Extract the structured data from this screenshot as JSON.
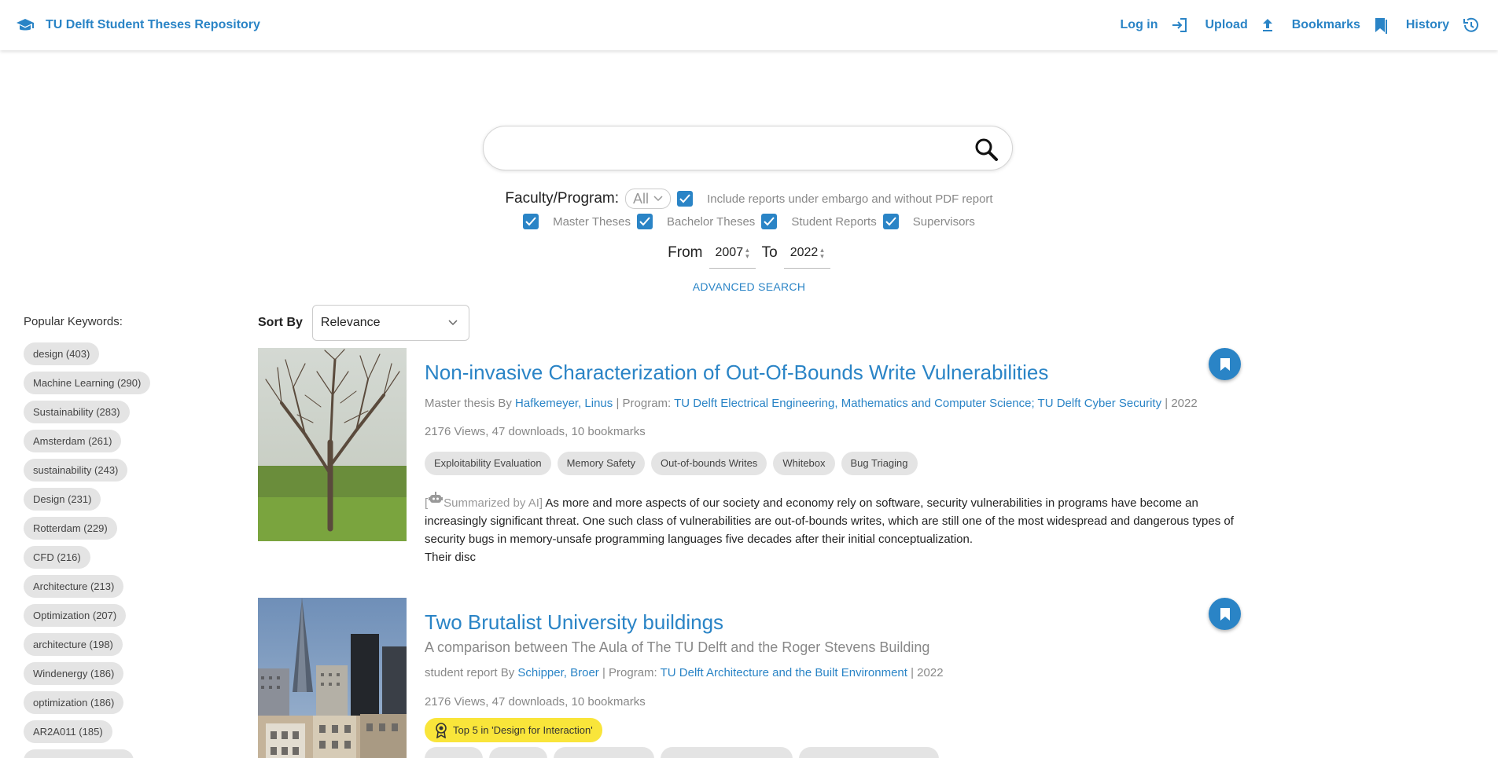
{
  "header": {
    "title": "TU Delft Student Theses Repository",
    "nav": {
      "login": "Log in",
      "upload": "Upload",
      "bookmarks": "Bookmarks",
      "history": "History"
    }
  },
  "search": {
    "value": "",
    "placeholder": ""
  },
  "filters": {
    "faculty_label": "Faculty/Program:",
    "faculty_value": "All",
    "embargo_label": "Include reports under embargo and without PDF report",
    "embargo_checked": true,
    "types": [
      {
        "label": "Master Theses",
        "checked": true
      },
      {
        "label": "Bachelor Theses",
        "checked": true
      },
      {
        "label": "Student Reports",
        "checked": true
      },
      {
        "label": "Supervisors",
        "checked": true
      }
    ],
    "from_label": "From",
    "from_year": "2007",
    "to_label": "To",
    "to_year": "2022",
    "advanced": "ADVANCED SEARCH"
  },
  "sort": {
    "label": "Sort By",
    "value": "Relevance"
  },
  "keywords": {
    "title": "Popular Keywords:",
    "items": [
      "design (403)",
      "Machine Learning (290)",
      "Sustainability (283)",
      "Amsterdam (261)",
      "sustainability (243)",
      "Design (231)",
      "Rotterdam (229)",
      "CFD (216)",
      "Architecture (213)",
      "Optimization (207)",
      "architecture (198)",
      "Windenergy (186)",
      "optimization (186)",
      "AR2A011 (185)"
    ]
  },
  "results": [
    {
      "title": "Non-invasive Characterization of Out-Of-Bounds Write Vulnerabilities",
      "type": "Master thesis By",
      "author": "Hafkemeyer, Linus",
      "program_label": "| Program:",
      "program": "TU Delft Electrical Engineering, Mathematics and Computer Science; TU Delft Cyber Security",
      "year": "| 2022",
      "stats": "2176 Views, 47 downloads, 10 bookmarks",
      "tags": [
        "Exploitability Evaluation",
        "Memory Safety",
        "Out-of-bounds Writes",
        "Whitebox",
        "Bug Triaging"
      ],
      "ai_label": "Summarized by AI]",
      "summary": "As more and more aspects of our society and economy rely on software, security vulnerabilities in programs have become an increasingly significant threat. One such class of vulnerabilities are out-of-bounds writes, which are still one of the most widespread and dangerous types of security bugs in memory-unsafe programming languages five decades after their initial conceptualization.",
      "summary_cont": "Their disc"
    },
    {
      "title": "Two Brutalist University buildings",
      "subtitle": "A comparison between The Aula of The TU Delft and the Roger Stevens Building",
      "type": "student report By",
      "author": "Schipper, Broer",
      "program_label": "| Program:",
      "program": "TU Delft Architecture and the Built Environment",
      "year": "| 2022",
      "stats": "2176 Views, 47 downloads, 10 bookmarks",
      "award": "Top 5 in 'Design for Interaction'"
    }
  ],
  "colors": {
    "accent": "#2a84c6",
    "chip": "#e4e4e4",
    "award": "#f9e53a"
  }
}
